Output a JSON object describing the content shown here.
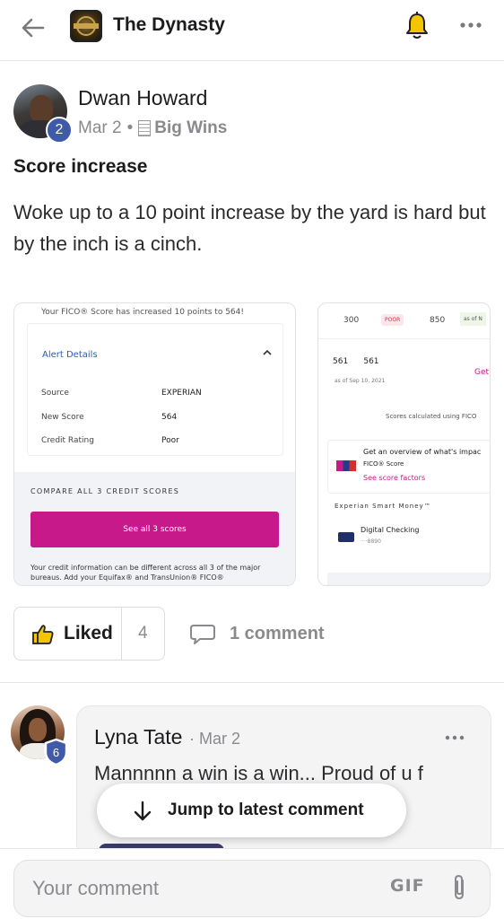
{
  "header": {
    "group_name": "The Dynasty",
    "logo_text": "DYNASTY"
  },
  "post": {
    "author": "Dwan Howard",
    "author_level": "2",
    "date": "Mar 2",
    "separator": "•",
    "topic": "Big Wins",
    "title": "Score increase",
    "body": "Woke up to a 10 point increase by the yard is hard but by the inch is a cinch."
  },
  "image1": {
    "headline": "Your FICO® Score has increased 10 points to 564!",
    "alert_title": "Alert Details",
    "rows": [
      {
        "label": "Source",
        "value": "EXPERIAN"
      },
      {
        "label": "New Score",
        "value": "564"
      },
      {
        "label": "Credit Rating",
        "value": "Poor"
      }
    ],
    "compare": "COMPARE ALL 3 CREDIT SCORES",
    "button": "See all 3 scores",
    "footnote": "Your credit information can be different across all 3 of the major bureaus. Add your Equifax® and TransUnion® FICO®"
  },
  "image2": {
    "scale_low": "300",
    "scale_label": "POOR",
    "scale_high": "850",
    "as_of_tag": "as of N",
    "score_a": "561",
    "score_b": "561",
    "get": "Get",
    "as_of_date": "as of Sep 10, 2021",
    "calc": "Scores calculated using FICO",
    "overview": "Get an overview of what's impac",
    "fico": "FICO® Score",
    "factors": "See score factors",
    "experian": "Experian Smart Money™",
    "digital": "Digital Checking",
    "digits": "····8890"
  },
  "reactions": {
    "like_label": "Liked",
    "like_count": "4",
    "comment_label": "1 comment"
  },
  "comment": {
    "author": "Lyna Tate",
    "author_level": "6",
    "date": "· Mar 2",
    "text": "Mannnnn a win is a win... Proud of u f"
  },
  "jump": {
    "label": "Jump to latest comment"
  },
  "composer": {
    "placeholder": "Your comment",
    "gif_label": "GIF"
  },
  "colors": {
    "accent_badge": "#3f5aa8",
    "bell": "#f2c500",
    "fico_pink": "#c8198a"
  },
  "icons": [
    "back-arrow-icon",
    "bell-icon",
    "more-icon",
    "thumbs-up-icon",
    "comment-icon",
    "arrow-down-icon",
    "paperclip-icon",
    "shield-badge-icon"
  ]
}
